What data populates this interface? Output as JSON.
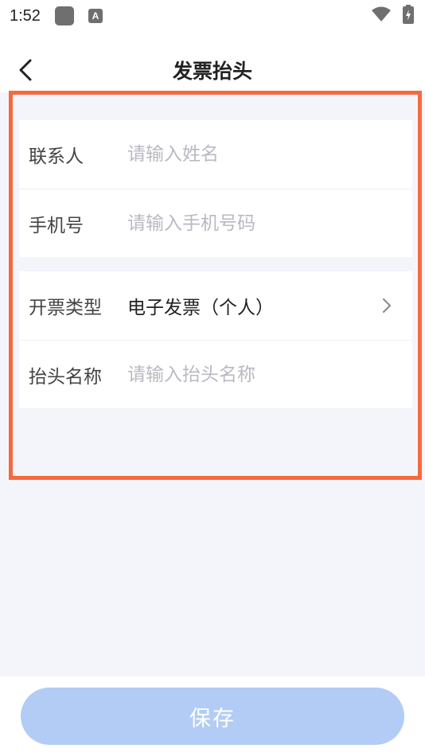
{
  "status_bar": {
    "time": "1:52",
    "icons": [
      "app-square-icon",
      "a-badge-icon",
      "wifi-icon",
      "battery-icon"
    ],
    "a_badge": "A"
  },
  "header": {
    "title": "发票抬头",
    "back_icon": "chevron-left-icon"
  },
  "form": {
    "contact": {
      "label": "联系人",
      "placeholder": "请输入姓名"
    },
    "phone": {
      "label": "手机号",
      "placeholder": "请输入手机号码"
    },
    "invoice_type": {
      "label": "开票类型",
      "value": "电子发票（个人）"
    },
    "title_name": {
      "label": "抬头名称",
      "placeholder": "请输入抬头名称"
    }
  },
  "footer": {
    "save_label": "保存"
  },
  "colors": {
    "highlight": "#f56a3d",
    "save_button": "#b3ccf5",
    "background": "#f4f5fa",
    "placeholder": "#b9b9c3"
  }
}
